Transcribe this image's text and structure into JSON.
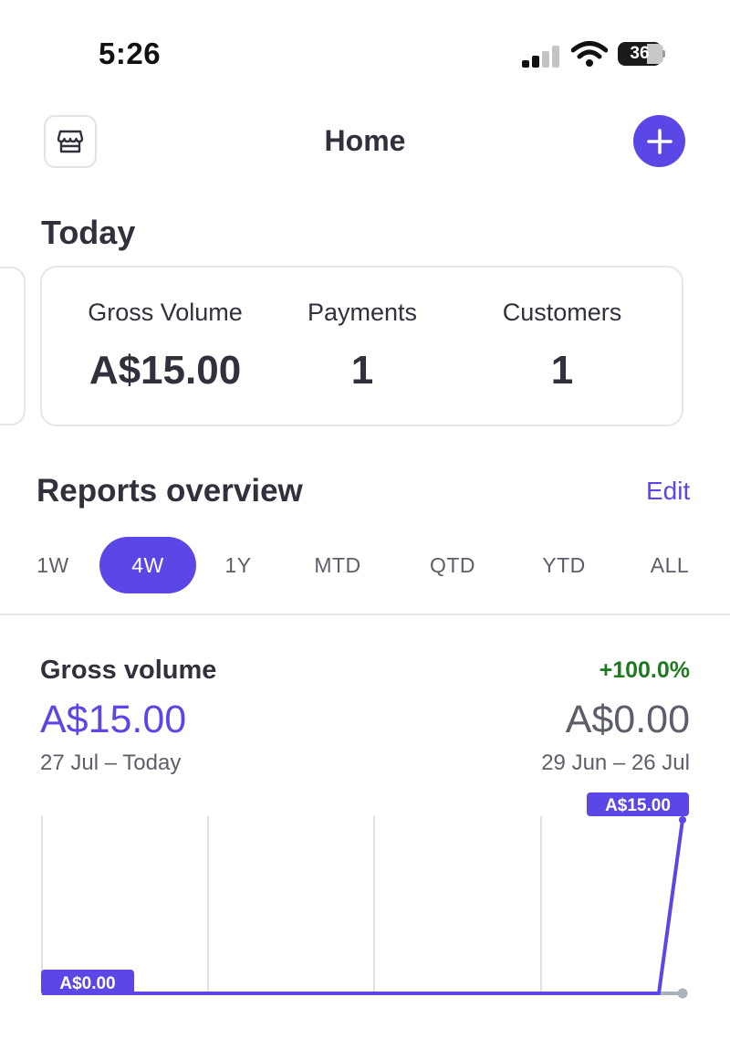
{
  "status_bar": {
    "time": "5:26",
    "battery_level": "36",
    "icons": [
      "signal-icon",
      "wifi-icon",
      "battery-icon"
    ]
  },
  "nav": {
    "title": "Home",
    "left_icon": "store-icon",
    "right_icon": "plus-icon"
  },
  "today": {
    "title": "Today",
    "metrics": [
      {
        "label": "Gross Volume",
        "value": "A$15.00"
      },
      {
        "label": "Payments",
        "value": "1"
      },
      {
        "label": "Customers",
        "value": "1"
      }
    ]
  },
  "reports": {
    "title": "Reports overview",
    "edit_label": "Edit",
    "tabs": [
      "1W",
      "4W",
      "1Y",
      "MTD",
      "QTD",
      "YTD",
      "ALL"
    ],
    "active_tab": "4W"
  },
  "gross_volume": {
    "title": "Gross volume",
    "change": "+100.0%",
    "current_value": "A$15.00",
    "current_range": "27 Jul – Today",
    "previous_value": "A$0.00",
    "previous_range": "29 Jun – 26 Jul"
  },
  "colors": {
    "accent": "#5b47e6",
    "positive": "#1f7a1f",
    "text": "#30313d",
    "muted": "#5c5f6b",
    "previous_series": "#aab1bd"
  },
  "chart_data": {
    "type": "line",
    "ylim": [
      0,
      15
    ],
    "min_label": "A$0.00",
    "max_label": "A$15.00",
    "series": [
      {
        "values": [
          0,
          0,
          0,
          0,
          0,
          0,
          0,
          0,
          0,
          0,
          0,
          0,
          0,
          0,
          0,
          0,
          0,
          0,
          0,
          0,
          0,
          0,
          0,
          0,
          0,
          0,
          0,
          15
        ]
      }
    ],
    "previous_series_values": [
      0,
      0
    ]
  }
}
